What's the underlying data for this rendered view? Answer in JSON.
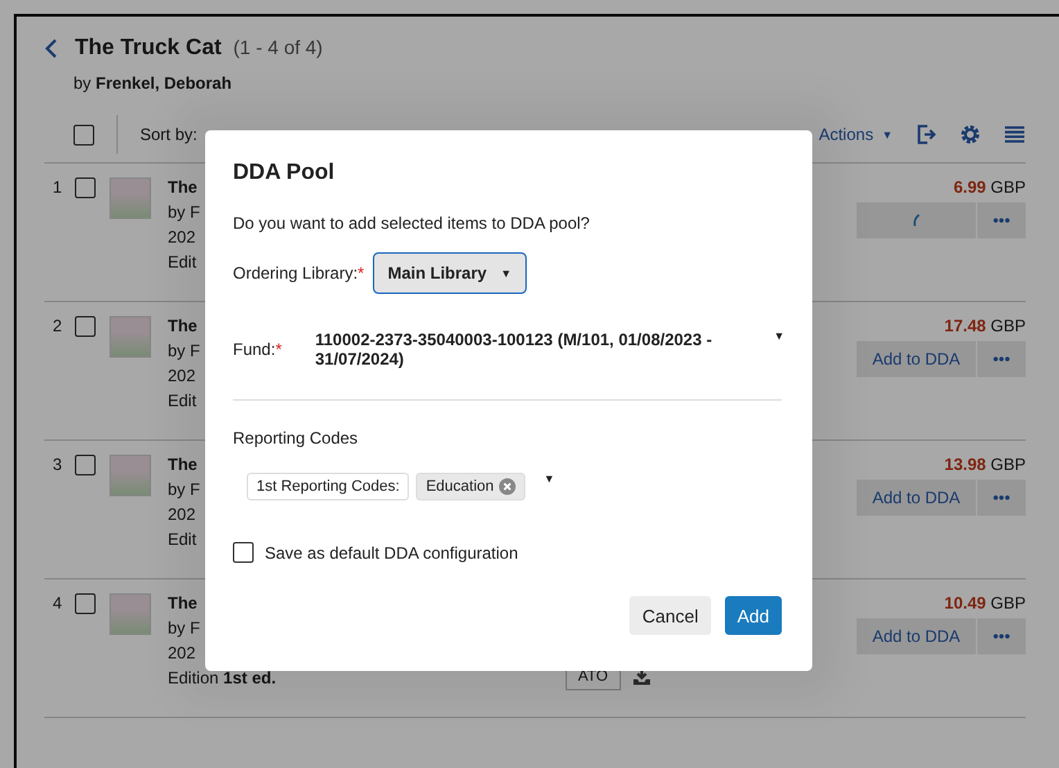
{
  "header": {
    "title": "The Truck Cat",
    "count": "(1 - 4 of 4)",
    "author": "by **Frenkel, Deborah**"
  },
  "toolbar": {
    "select_all_checked": false,
    "sort_label": "Sort by:",
    "actions_label": "Actions",
    "actions_caret": "▼"
  },
  "rows": [
    {
      "number": "1",
      "checked": false,
      "title": "The",
      "author": "by F",
      "year": "202",
      "edition": "Edit",
      "price": "6.99",
      "currency": "GBP",
      "loading": true,
      "more": "•••"
    },
    {
      "number": "2",
      "checked": false,
      "title": "The",
      "author": "by F",
      "year": "202",
      "edition": "Edit",
      "price": "17.48",
      "currency": "GBP",
      "loading": false,
      "action_label": "Add to DDA",
      "more": "•••"
    },
    {
      "number": "3",
      "checked": false,
      "title": "The",
      "author": "by F",
      "year": "202",
      "edition": "Edit",
      "price": "13.98",
      "currency": "GBP",
      "loading": false,
      "action_label": "Add to DDA",
      "more": "•••"
    },
    {
      "number": "4",
      "checked": false,
      "title": "The",
      "author": "by F",
      "year": "202",
      "edition": "Edition **1st ed.**",
      "price": "10.49",
      "currency": "GBP",
      "loading": false,
      "action_label": "Add to DDA",
      "more": "•••",
      "badge": "ATO"
    }
  ],
  "dialog": {
    "title": "DDA Pool",
    "question": "Do you want to add selected items to DDA pool?",
    "library_label": "Ordering Library:",
    "library_value": "Main Library",
    "caret": "▼",
    "fund_label": "Fund:",
    "fund_value": "110002-2373-35040003-100123 (M/101, 01/08/2023 - 31/07/2024)",
    "required_mark": "*",
    "reporting_title": "Reporting Codes",
    "reporting_label": "1st Reporting Codes:",
    "reporting_value": "Education",
    "save_default_label": "Save as default DDA configuration",
    "save_default_checked": false,
    "buttons": [
      {
        "label": "Cancel",
        "kind": "secondary"
      },
      {
        "label": "Add",
        "kind": "primary"
      }
    ]
  }
}
